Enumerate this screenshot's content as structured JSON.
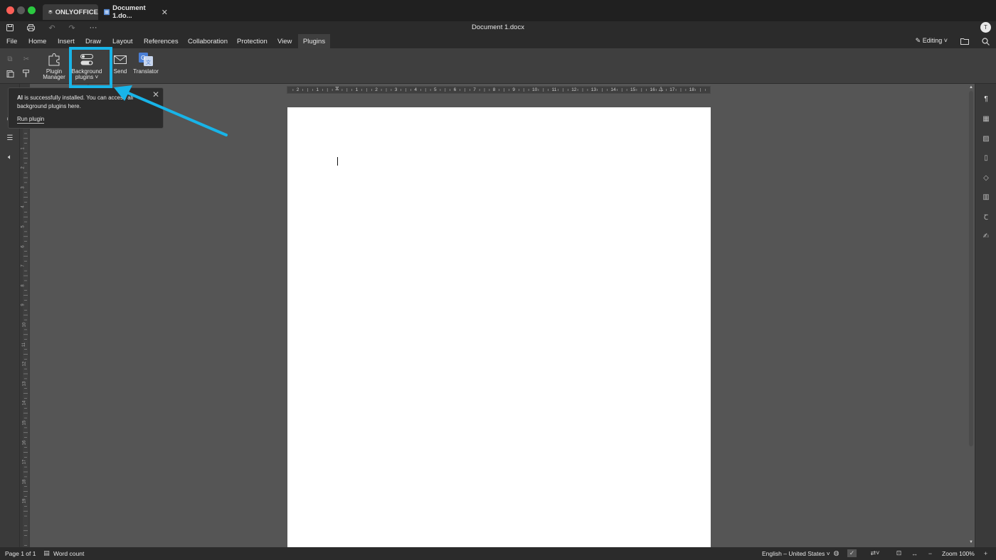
{
  "tabs": {
    "app_logo_label": "ONLYOFFICE",
    "document_tab_label": "Document 1.do..."
  },
  "quickbar": {
    "document_title": "Document 1.docx",
    "more_label": "···",
    "avatar_initial": "T"
  },
  "menu": {
    "items": [
      "File",
      "Home",
      "Insert",
      "Draw",
      "Layout",
      "References",
      "Collaboration",
      "Protection",
      "View",
      "Plugins"
    ],
    "active": "Plugins",
    "editing_label": "Editing"
  },
  "toolbar": {
    "plugin_manager_line1": "Plugin",
    "plugin_manager_line2": "Manager",
    "background_plugins_line1": "Background",
    "background_plugins_line2": "plugins",
    "send_label": "Send",
    "translator_label": "Translator"
  },
  "popup": {
    "bold_text": "AI",
    "message_line1_rest": " is successfully installed. You can access all",
    "message_line2": "background plugins here.",
    "run_label": "Run plugin"
  },
  "ruler": {
    "horizontal_numbers": [
      "2",
      "1",
      "1",
      "2",
      "3",
      "4",
      "5",
      "6",
      "7",
      "8",
      "9",
      "10",
      "11",
      "12",
      "13",
      "14",
      "15",
      "16",
      "17",
      "18"
    ],
    "vertical_numbers": [
      "1",
      "2",
      "3",
      "4",
      "5",
      "6",
      "7",
      "8",
      "9",
      "10",
      "11",
      "12",
      "13",
      "14",
      "15",
      "16",
      "17",
      "18",
      "19"
    ]
  },
  "statusbar": {
    "page_info": "Page 1 of 1",
    "word_count": "Word count",
    "language": "English – United States",
    "zoom": "Zoom 100%"
  },
  "colors": {
    "highlight": "#18b4e8",
    "titlebar": "#202020",
    "canvas": "#555555"
  }
}
